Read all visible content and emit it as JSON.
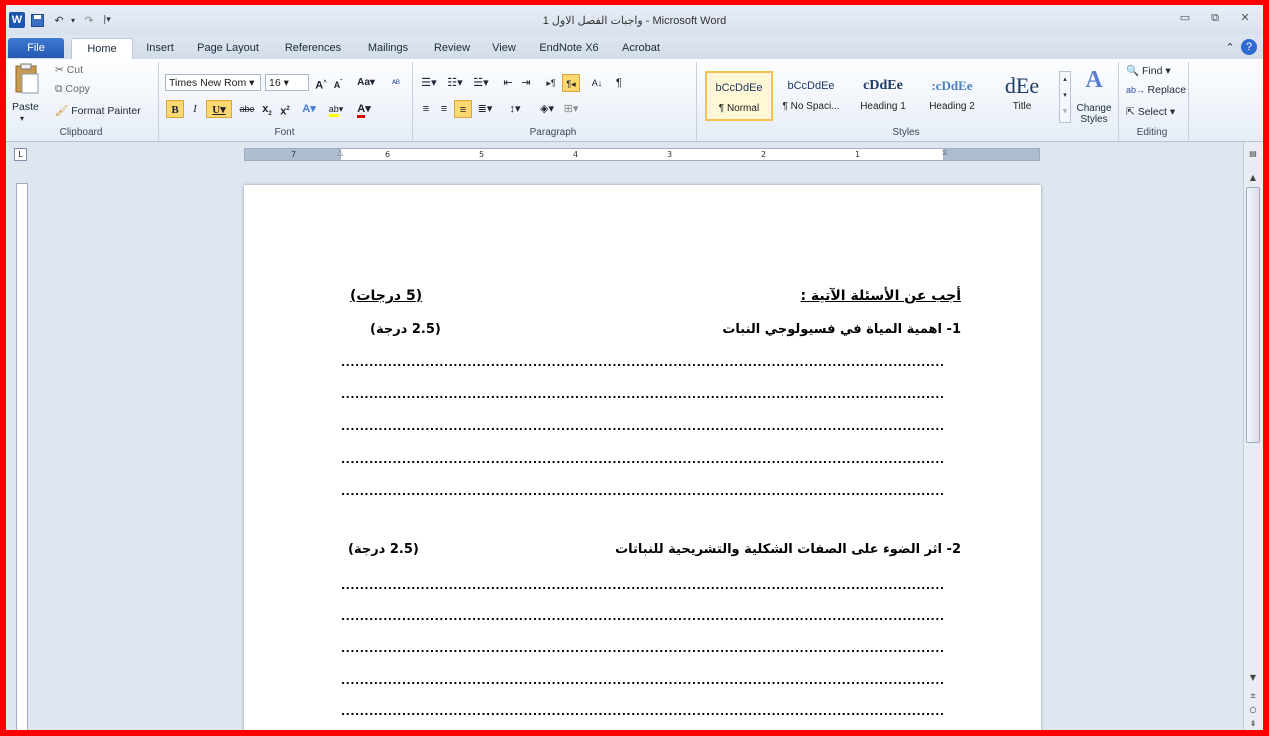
{
  "window": {
    "title": "واجبات الفصل الاول 1 - Microsoft Word",
    "app_icon": "W",
    "quick_access": [
      "save-icon",
      "undo-icon",
      "redo-icon",
      "customize-icon"
    ]
  },
  "tabs": [
    "File",
    "Home",
    "Insert",
    "Page Layout",
    "References",
    "Mailings",
    "Review",
    "View",
    "EndNote X6",
    "Acrobat"
  ],
  "ribbon": {
    "clipboard": {
      "paste": "Paste",
      "cut": "Cut",
      "copy": "Copy",
      "format_painter": "Format Painter",
      "label": "Clipboard"
    },
    "font": {
      "name": "Times New Rom",
      "size": "16",
      "label": "Font"
    },
    "paragraph": {
      "label": "Paragraph"
    },
    "styles": {
      "label": "Styles",
      "items": [
        {
          "sample": "bCcDdEe",
          "name": "¶ Normal"
        },
        {
          "sample": "bCcDdEe",
          "name": "¶ No Spaci..."
        },
        {
          "sample": "cDdEe",
          "name": "Heading 1"
        },
        {
          "sample": ":cDdEe",
          "name": "Heading 2"
        },
        {
          "sample": "dEe",
          "name": "Title"
        }
      ],
      "change_styles": "Change Styles"
    },
    "editing": {
      "find": "Find",
      "replace": "Replace",
      "select": "Select",
      "label": "Editing"
    }
  },
  "ruler": {
    "numbers": [
      "7",
      "6",
      "5",
      "4",
      "3",
      "2",
      "1"
    ],
    "corner": "L"
  },
  "document": {
    "heading": "أجب عن الأسئلة الآتية :",
    "heading_marks": "(5 درجات)",
    "q1": "1-  اهمية المياة في فسيولوجي النبات",
    "q1_marks": "(2.5 درجة)",
    "q2": "2- اثر الضوء على الصفات الشكلية والتشريحية للنباتات",
    "q2_marks": "(2.5 درجة)",
    "dots": "...................................................................................................................................................................."
  }
}
